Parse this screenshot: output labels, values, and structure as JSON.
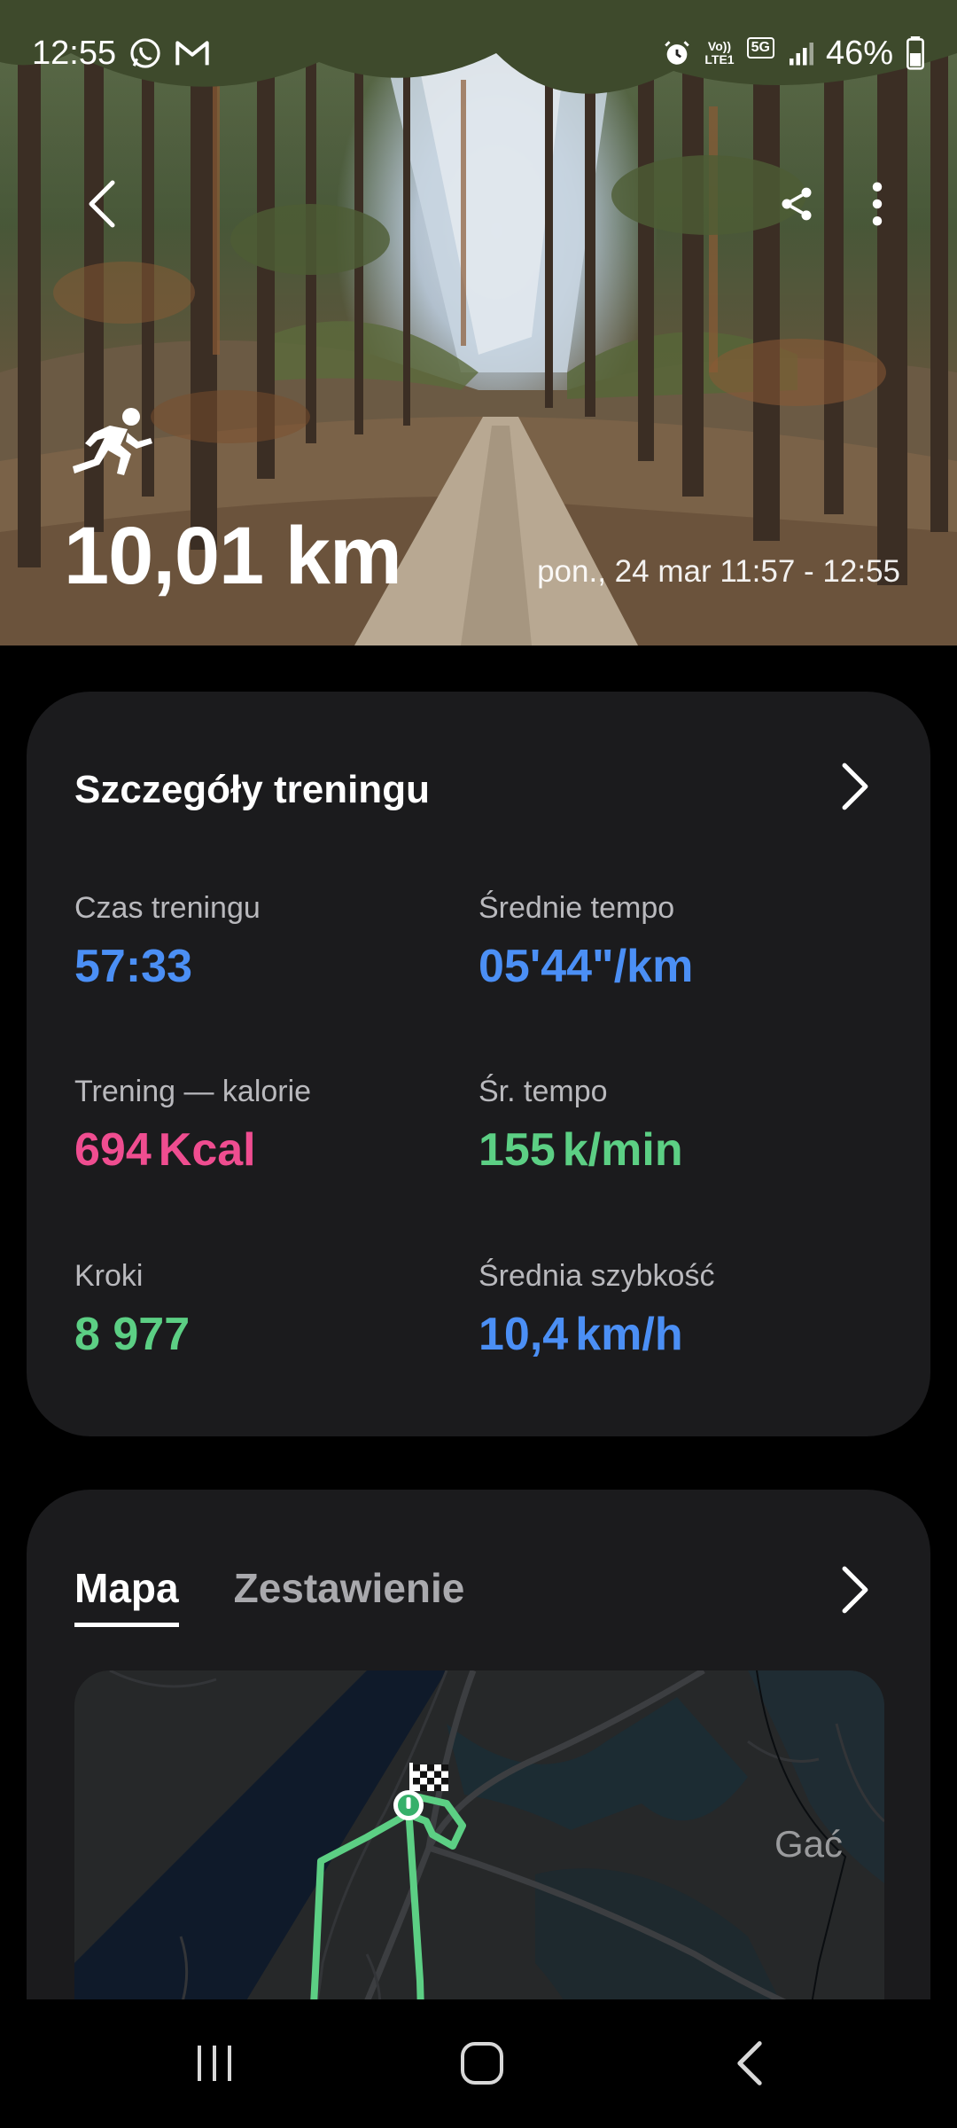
{
  "status_bar": {
    "time": "12:55",
    "left_icons": [
      "whatsapp-icon",
      "gmail-icon"
    ],
    "right_icons": [
      "alarm-icon",
      "volte-icon",
      "5g-icon",
      "signal-icon"
    ],
    "network_label": "5G",
    "volte_label": "Vo))",
    "lte_label": "LTE1",
    "battery": "46%"
  },
  "hero": {
    "activity_icon": "running-icon",
    "distance": "10,01 km",
    "date_range": "pon., 24 mar 11:57 - 12:55"
  },
  "details": {
    "title": "Szczegóły treningu",
    "stats": [
      {
        "label": "Czas treningu",
        "value": "57:33",
        "unit": "",
        "color": "#4b8ff5"
      },
      {
        "label": "Średnie tempo",
        "value": "05'44\"",
        "unit": "/km",
        "color": "#4b8ff5"
      },
      {
        "label": "Trening — kalorie",
        "value": "694",
        "unit": "Kcal",
        "color": "#ef4d90"
      },
      {
        "label": "Śr. tempo",
        "value": "155",
        "unit": "k/min",
        "color": "#5ccf84"
      },
      {
        "label": "Kroki",
        "value": "8 977",
        "unit": "",
        "color": "#5ccf84"
      },
      {
        "label": "Średnia szybkość",
        "value": "10,4",
        "unit": "km/h",
        "color": "#4b8ff5"
      }
    ]
  },
  "map": {
    "tabs": [
      {
        "label": "Mapa",
        "active": true
      },
      {
        "label": "Zestawienie",
        "active": false
      }
    ],
    "place_label": "Gać",
    "route_color": "#5ccf84"
  }
}
